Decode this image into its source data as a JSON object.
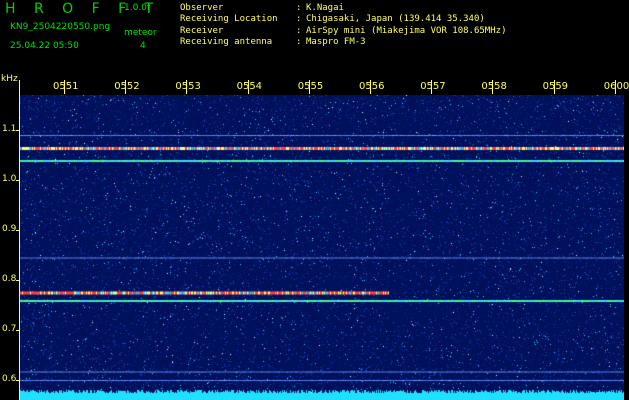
{
  "app": {
    "logo": "H R O F F T",
    "version": "1.0.0f"
  },
  "file": {
    "name": "KN9_2504220550.png",
    "datetime": "25.04.22 05:50"
  },
  "meteor": {
    "label": "meteor",
    "count": "4"
  },
  "station": {
    "rows": [
      {
        "label": "Observer",
        "sep": ":",
        "value": "K.Nagai"
      },
      {
        "label": "Receiving Location",
        "sep": ":",
        "value": "Chigasaki, Japan (139.414 35.340)"
      },
      {
        "label": "Receiver",
        "sep": ":",
        "value": "AirSpy mini (Miakejima VOR 108.65MHz)"
      },
      {
        "label": "Receiving antenna",
        "sep": ":",
        "value": "Maspro FM-3"
      }
    ]
  },
  "chart_data": {
    "type": "heatmap",
    "ylabel": "kHz",
    "yticks": [
      "1.1",
      "1.0",
      "0.9",
      "0.8",
      "0.7",
      "0.6"
    ],
    "ytick_values": [
      1.1,
      1.0,
      0.9,
      0.8,
      0.7,
      0.6
    ],
    "xticks": [
      "0551",
      "0552",
      "0553",
      "0554",
      "0555",
      "0556",
      "0557",
      "0558",
      "0559",
      "0600"
    ],
    "ylim": [
      0.57,
      1.13
    ],
    "xlim_minutes": [
      0,
      10
    ],
    "carriers": [
      {
        "freq_khz": 1.09,
        "t_start": 0,
        "t_end": 10,
        "strength": "weak"
      },
      {
        "freq_khz": 1.064,
        "t_start": 0,
        "t_end": 10,
        "strength": "strong"
      },
      {
        "freq_khz": 1.04,
        "t_start": 0,
        "t_end": 10,
        "strength": "medium"
      },
      {
        "freq_khz": 0.775,
        "t_start": 0,
        "t_end": 5.3,
        "strength": "strong"
      },
      {
        "freq_khz": 0.76,
        "t_start": 0,
        "t_end": 10,
        "strength": "medium"
      },
      {
        "freq_khz": 0.845,
        "t_start": 0,
        "t_end": 10,
        "strength": "weak"
      },
      {
        "freq_khz": 0.617,
        "t_start": 0,
        "t_end": 10,
        "strength": "weak"
      },
      {
        "freq_khz": 0.6,
        "t_start": 0,
        "t_end": 10,
        "strength": "weak"
      }
    ],
    "colors": {
      "background": "#00105a",
      "noise_mid": "#2050c0",
      "noise_high": "#40d0ff",
      "signal": "#ff4040",
      "baseline": "#20e0ff"
    }
  }
}
